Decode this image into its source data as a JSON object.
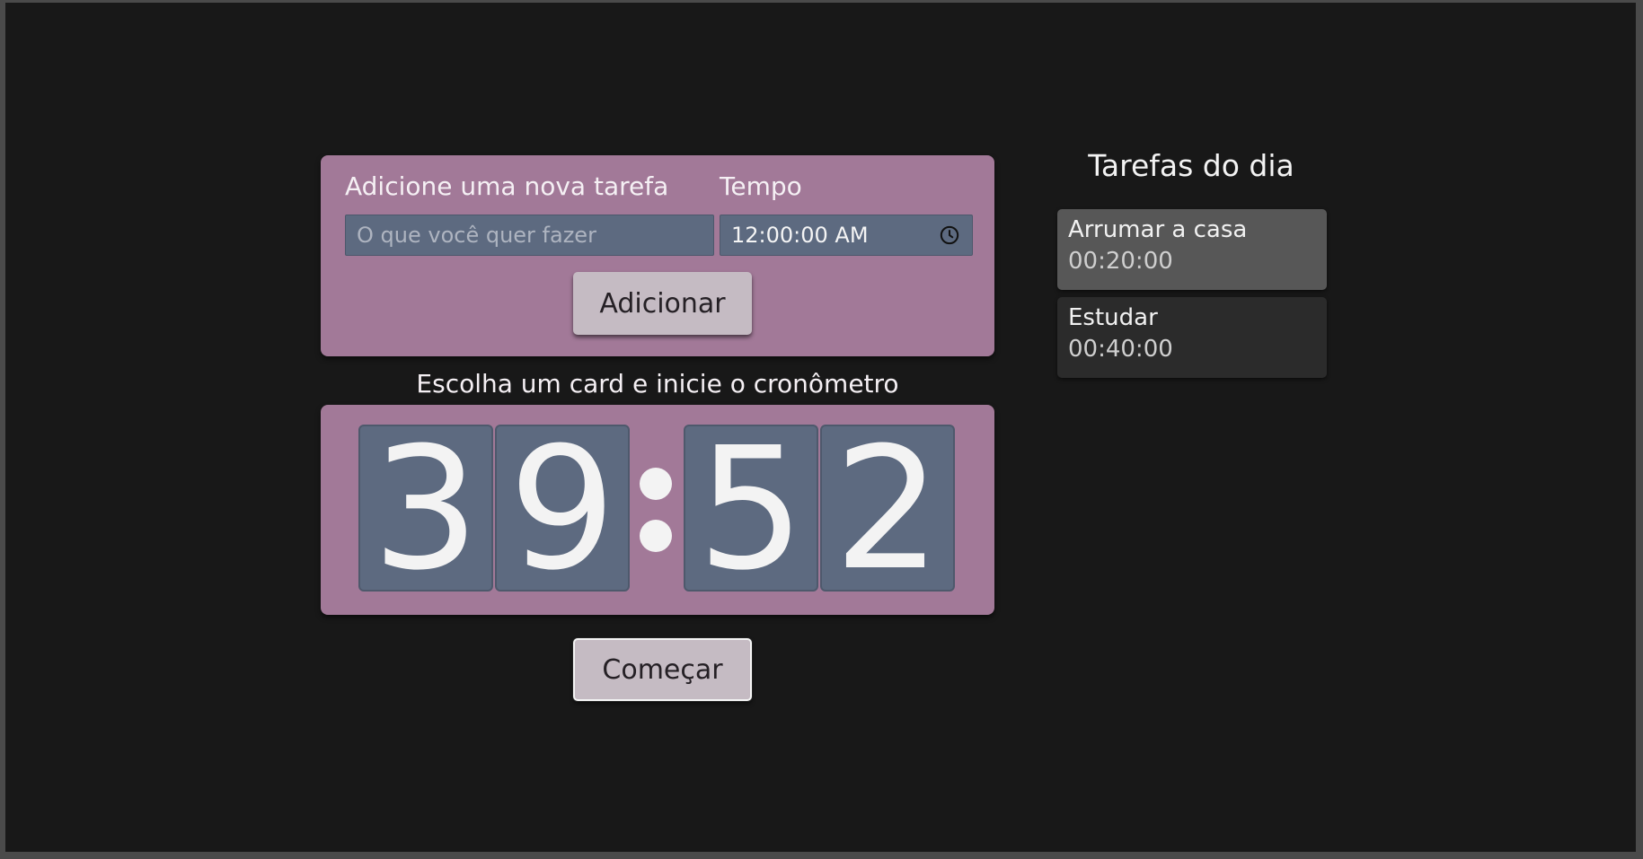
{
  "form": {
    "task_label": "Adicione uma nova tarefa",
    "time_label": "Tempo",
    "task_placeholder": "O que você quer fazer",
    "task_value": "",
    "time_value": "12:00:00 AM",
    "add_button": "Adicionar"
  },
  "timer": {
    "caption": "Escolha um card e inicie o cronômetro",
    "digits": [
      "3",
      "9",
      "5",
      "2"
    ],
    "separator": ":",
    "start_button": "Começar"
  },
  "task_list": {
    "title": "Tarefas do dia",
    "items": [
      {
        "name": "Arrumar a casa",
        "time": "00:20:00",
        "selected": true
      },
      {
        "name": "Estudar",
        "time": "00:40:00",
        "selected": false
      }
    ]
  },
  "icons": {
    "time_field": "clock-icon"
  },
  "colors": {
    "background": "#181818",
    "card": "#a27998",
    "input": "#5d6a80",
    "button": "#c5bbc3",
    "task_selected": "#575757",
    "task_normal": "#2b2b2b"
  }
}
